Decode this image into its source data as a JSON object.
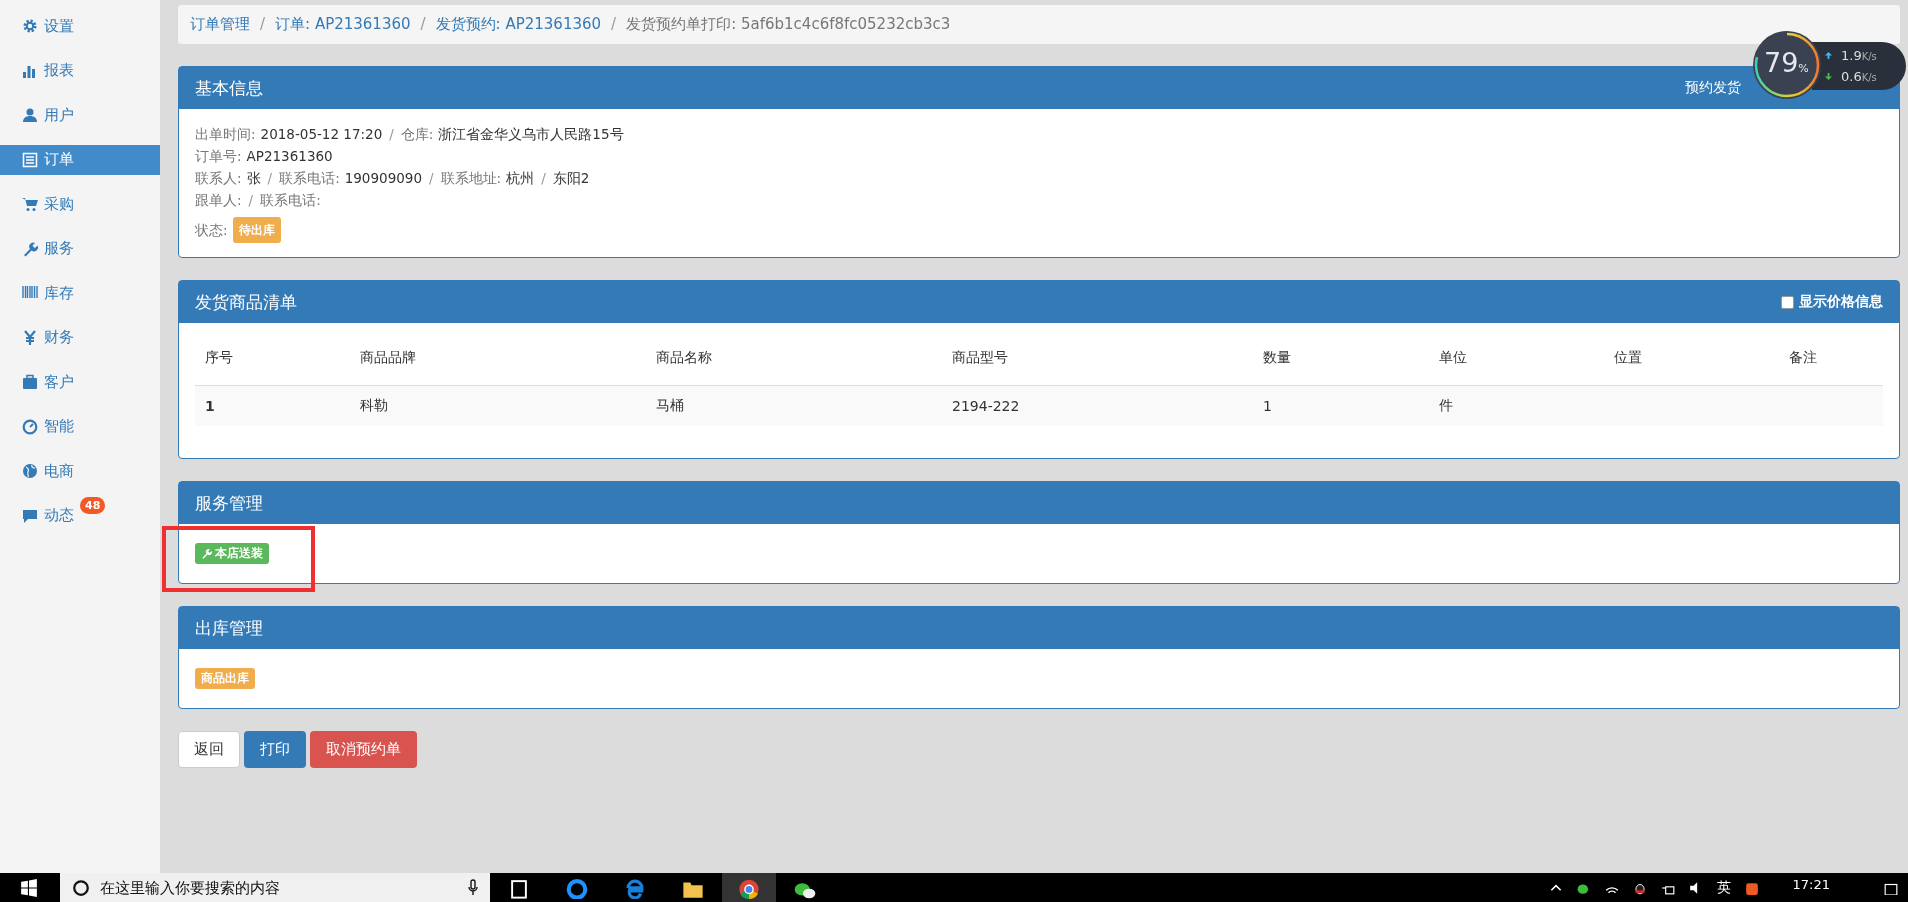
{
  "sidebar": {
    "items": [
      {
        "label": "设置",
        "selected": false
      },
      {
        "label": "报表",
        "selected": false
      },
      {
        "label": "用户",
        "selected": false
      },
      {
        "label": "订单",
        "selected": true
      },
      {
        "label": "采购",
        "selected": false
      },
      {
        "label": "服务",
        "selected": false
      },
      {
        "label": "库存",
        "selected": false
      },
      {
        "label": "财务",
        "selected": false
      },
      {
        "label": "客户",
        "selected": false
      },
      {
        "label": "智能",
        "selected": false
      },
      {
        "label": "电商",
        "selected": false
      },
      {
        "label": "动态",
        "selected": false,
        "badge": "48"
      }
    ]
  },
  "breadcrumb": {
    "separator": "/",
    "items": [
      {
        "label": "订单管理",
        "link": true
      },
      {
        "label": "订单: AP21361360",
        "link": true
      },
      {
        "label": "发货预约: AP21361360",
        "link": true
      },
      {
        "label": "发货预约单打印: 5af6b1c4c6f8fc05232cb3c3",
        "link": false
      }
    ]
  },
  "basic_info": {
    "title": "基本信息",
    "header_right": "预约发货",
    "separator": "/",
    "lines": [
      [
        {
          "label": "出单时间:",
          "value": "2018-05-12 17:20"
        },
        {
          "label": "仓库:",
          "value": "浙江省金华义乌市人民路15号"
        }
      ],
      [
        {
          "label": "订单号:",
          "value": "AP21361360"
        }
      ],
      [
        {
          "label": "联系人:",
          "value": "张"
        },
        {
          "label": "联系电话:",
          "value": "190909090"
        },
        {
          "label": "联系地址:",
          "value": "杭州"
        },
        {
          "value": "东阳2"
        }
      ],
      [
        {
          "label": "跟单人:"
        },
        {
          "label": "联系电话:"
        }
      ]
    ],
    "status": {
      "label": "状态:",
      "value": "待出库"
    }
  },
  "goods": {
    "title": "发货商品清单",
    "show_price": {
      "label": "显示价格信息",
      "checked": false
    },
    "columns": [
      "序号",
      "商品品牌",
      "商品名称",
      "商品型号",
      "数量",
      "单位",
      "位置",
      "备注"
    ],
    "rows": [
      [
        "1",
        "科勒",
        "马桶",
        "2194-222",
        "1",
        "件",
        "",
        ""
      ]
    ]
  },
  "service": {
    "title": "服务管理",
    "tag": "本店送装",
    "highlighted": true
  },
  "outbound": {
    "title": "出库管理",
    "tag": "商品出库"
  },
  "buttons": [
    {
      "label": "返回",
      "kind": "default"
    },
    {
      "label": "打印",
      "kind": "primary"
    },
    {
      "label": "取消预约单",
      "kind": "danger"
    }
  ],
  "monitor": {
    "percent": "79",
    "percent_sign": "%",
    "up": "1.9",
    "up_unit": "K/s",
    "down": "0.6",
    "down_unit": "K/s"
  },
  "taskbar": {
    "search_placeholder": "在这里输入你要搜索的内容",
    "ime": "英",
    "time": "17:21"
  }
}
